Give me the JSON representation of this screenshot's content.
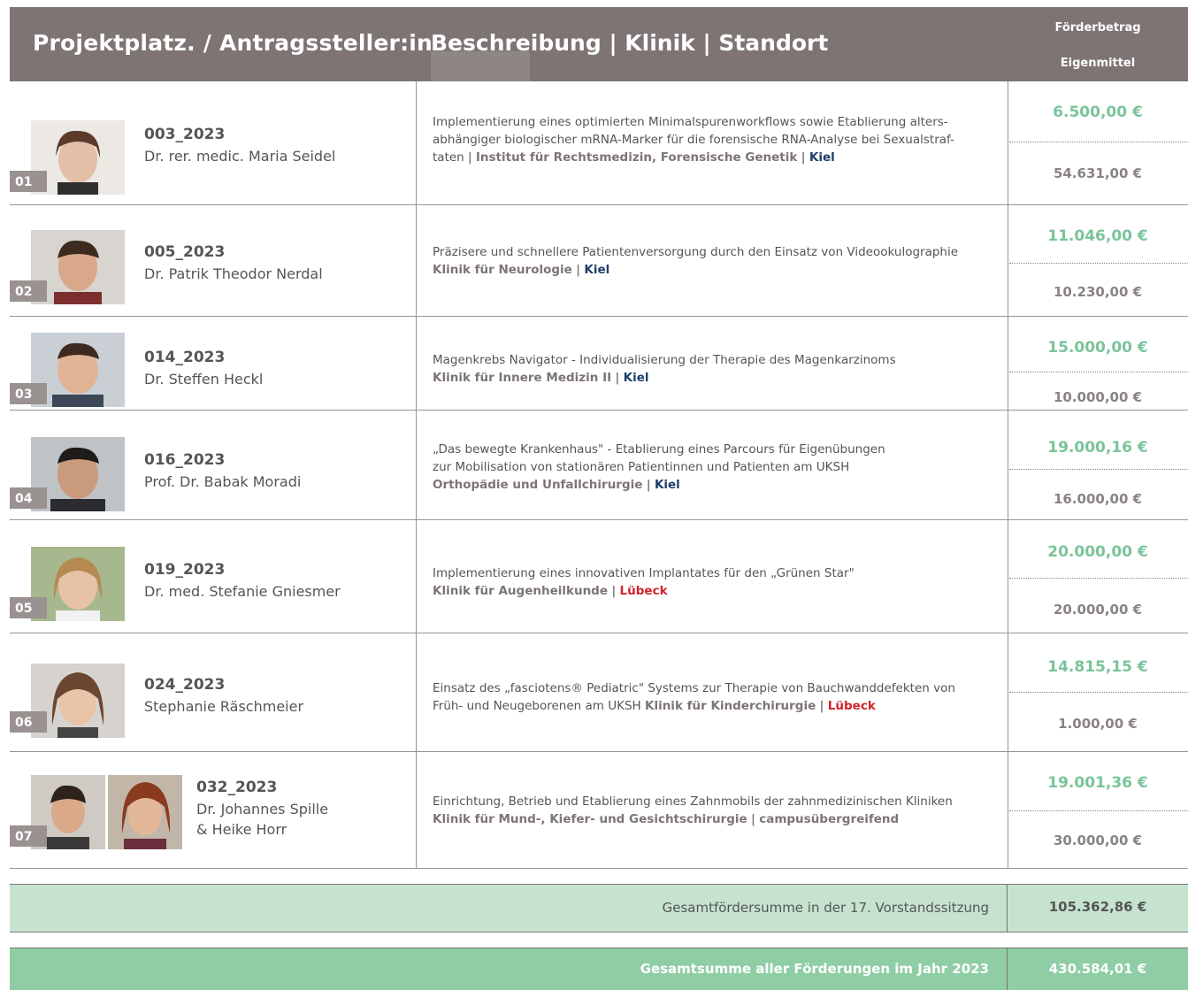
{
  "header": {
    "col1": "Projektplatz. / Antragssteller:in",
    "col2": "Beschreibung | Klinik | Standort",
    "col3a": "Förderbetrag",
    "col3b": "Eigenmittel"
  },
  "rows": [
    {
      "num": "01",
      "id": "003_2023",
      "name": "Dr. rer. medic. Maria Seidel",
      "desc1": "Implementierung eines optimierten Minimalspurenworkflows sowie Etablierung alters-",
      "desc2": "abhängiger biologischer mRNA-Marker für die forensische RNA-Analyse bei Sexualstraf-",
      "desc3a": "taten |",
      "clinic": "Institut für Rechtsmedizin, Forensische Genetik",
      "sep": "|",
      "site": "Kiel",
      "foerder": "6.500,00 €",
      "eigen": "54.631,00 €"
    },
    {
      "num": "02",
      "id": "005_2023",
      "name": "Dr. Patrik Theodor Nerdal",
      "desc1": "Präzisere und schnellere Patientenversorgung durch den Einsatz von Videookulographie",
      "clinic": "Klinik für Neurologie",
      "sep": "|",
      "site": "Kiel",
      "foerder": "11.046,00 €",
      "eigen": "10.230,00 €"
    },
    {
      "num": "03",
      "id": "014_2023",
      "name": "Dr. Steffen Heckl",
      "desc1": "Magenkrebs Navigator - Individualisierung der Therapie des Magenkarzinoms",
      "clinic": "Klinik für Innere Medizin II",
      "sep": "|",
      "site": "Kiel",
      "foerder": "15.000,00 €",
      "eigen": "10.000,00 €"
    },
    {
      "num": "04",
      "id": "016_2023",
      "name": "Prof. Dr. Babak Moradi",
      "desc1": "„Das bewegte Krankenhaus\" - Etablierung eines Parcours für Eigenübungen",
      "desc2": "zur Mobilisation von stationären Patientinnen und Patienten am UKSH",
      "clinic": "Orthopädie und Unfallchirurgie",
      "sep": "|",
      "site": "Kiel",
      "foerder": "19.000,16 €",
      "eigen": "16.000,00 €"
    },
    {
      "num": "05",
      "id": "019_2023",
      "name": "Dr. med. Stefanie Gniesmer",
      "desc1": "Implementierung eines innovativen Implantates für den „Grünen Star\"",
      "clinic": "Klinik für Augenheilkunde",
      "sep": "|",
      "site": "Lübeck",
      "foerder": "20.000,00 €",
      "eigen": "20.000,00 €"
    },
    {
      "num": "06",
      "id": "024_2023",
      "name": "Stephanie Räschmeier",
      "desc1": "Einsatz des „fasciotens® Pediatric\" Systems zur Therapie von Bauchwanddefekten von",
      "desc2a": "Früh- und Neugeborenen am UKSH",
      "clinic": "Klinik für Kinderchirurgie",
      "sep": "|",
      "site": "Lübeck",
      "foerder": "14.815,15 €",
      "eigen": "1.000,00 €"
    },
    {
      "num": "07",
      "id": "032_2023",
      "name": "Dr. Johannes Spille",
      "name2": "& Heike Horr",
      "desc1": "Einrichtung, Betrieb und Etablierung eines Zahnmobils der zahnmedizinischen Kliniken",
      "clinic": "Klinik für Mund-, Kiefer- und Gesichtschirurgie",
      "sep": "|",
      "site": "campusübergreifend",
      "foerder": "19.001,36 €",
      "eigen": "30.000,00 €"
    }
  ],
  "totals": {
    "session_label": "Gesamtfördersumme in der 17. Vorstandssitzung",
    "session_value": "105.362,86 €",
    "year_label": "Gesamtsumme aller Förderungen im Jahr 2023",
    "year_value": "430.584,01 €"
  },
  "colors": {
    "header": "#7e7474",
    "green": "#7ac49a",
    "kiel": "#1f3f6b",
    "luebeck": "#d2232a",
    "sum_light": "#c5e3cf",
    "sum_dark": "#8fcda5"
  }
}
